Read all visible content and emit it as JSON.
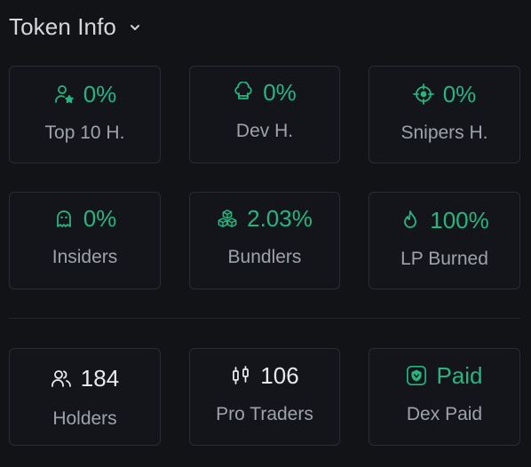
{
  "header": {
    "title": "Token Info",
    "chevron_icon": "chevron-down-icon"
  },
  "colors": {
    "accent_green": "#26b57f",
    "card_border": "#2a2c33",
    "background": "#121317",
    "label_gray": "#9ea2ab"
  },
  "stats_row1": [
    {
      "icon": "user-star-icon",
      "value": "0%",
      "label": "Top 10 H."
    },
    {
      "icon": "chef-hat-icon",
      "value": "0%",
      "label": "Dev H."
    },
    {
      "icon": "crosshair-icon",
      "value": "0%",
      "label": "Snipers H."
    }
  ],
  "stats_row2": [
    {
      "icon": "ghost-icon",
      "value": "0%",
      "label": "Insiders"
    },
    {
      "icon": "boxes-icon",
      "value": "2.03%",
      "label": "Bundlers"
    },
    {
      "icon": "flame-icon",
      "value": "100%",
      "label": "LP Burned"
    }
  ],
  "stats_row3": [
    {
      "icon": "users-icon",
      "value": "184",
      "label": "Holders"
    },
    {
      "icon": "candlestick-icon",
      "value": "106",
      "label": "Pro Traders"
    },
    {
      "icon": "dex-shield-icon",
      "value": "Paid",
      "label": "Dex Paid"
    }
  ]
}
